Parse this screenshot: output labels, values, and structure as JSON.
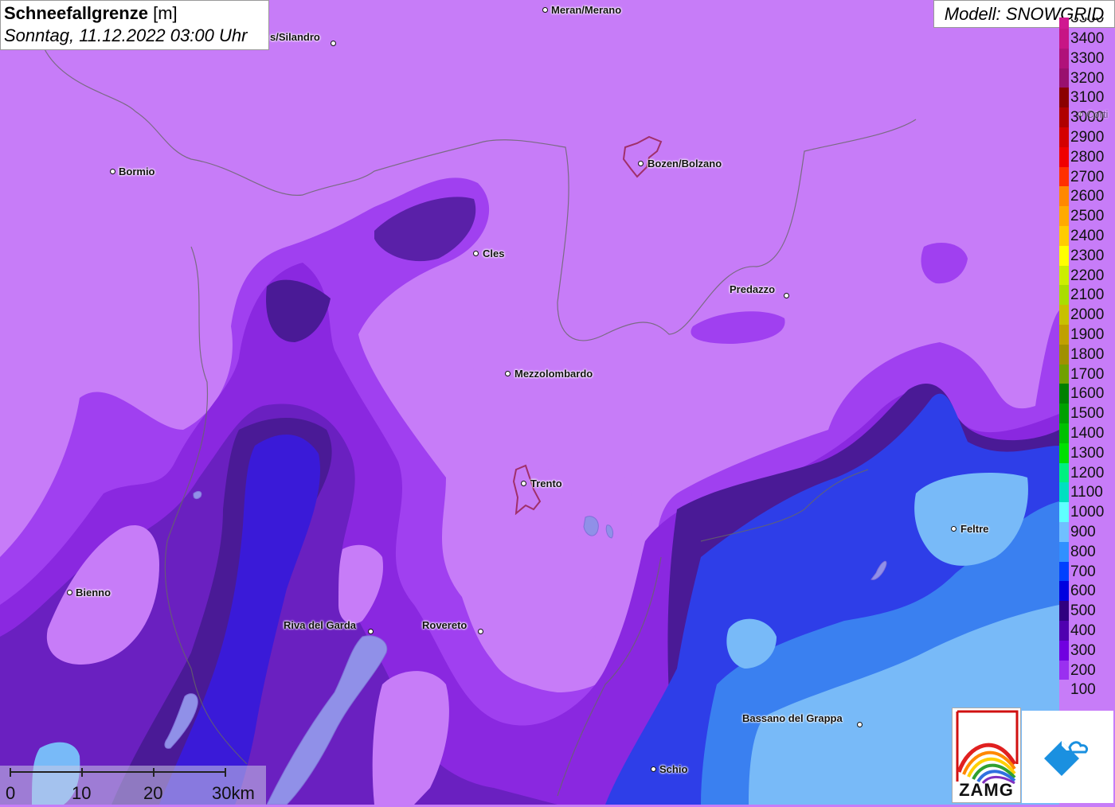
{
  "header": {
    "title_bold": "Schneefallgrenze",
    "title_unit": "[m]",
    "datetime": "Sonntag, 11.12.2022 03:00 Uhr"
  },
  "model": {
    "label": "Modell: SNOWGRID"
  },
  "legend": {
    "top_label_partial": "3500",
    "entries": [
      {
        "value": "3400",
        "color": "#c71585"
      },
      {
        "value": "3300",
        "color": "#b0127a"
      },
      {
        "value": "3200",
        "color": "#99106e"
      },
      {
        "value": "3100",
        "color": "#8b0000"
      },
      {
        "value": "3000",
        "color": "#b00000"
      },
      {
        "value": "2900",
        "color": "#d40000"
      },
      {
        "value": "2800",
        "color": "#f00000"
      },
      {
        "value": "2700",
        "color": "#ff3000"
      },
      {
        "value": "2600",
        "color": "#ff8800"
      },
      {
        "value": "2500",
        "color": "#ffaa00"
      },
      {
        "value": "2400",
        "color": "#ffcc00"
      },
      {
        "value": "2300",
        "color": "#ffff00"
      },
      {
        "value": "2200",
        "color": "#ccee00"
      },
      {
        "value": "2100",
        "color": "#aadd00"
      },
      {
        "value": "2000",
        "color": "#c8c000"
      },
      {
        "value": "1900",
        "color": "#c0a000"
      },
      {
        "value": "1800",
        "color": "#a09000"
      },
      {
        "value": "1700",
        "color": "#70a000"
      },
      {
        "value": "1600",
        "color": "#008000"
      },
      {
        "value": "1500",
        "color": "#00a000"
      },
      {
        "value": "1400",
        "color": "#00c000"
      },
      {
        "value": "1300",
        "color": "#00e000"
      },
      {
        "value": "1200",
        "color": "#00f080"
      },
      {
        "value": "1100",
        "color": "#00e0c0"
      },
      {
        "value": "1000",
        "color": "#60ffff"
      },
      {
        "value": "900",
        "color": "#70c0ff"
      },
      {
        "value": "800",
        "color": "#3090ff"
      },
      {
        "value": "700",
        "color": "#0040ff"
      },
      {
        "value": "600",
        "color": "#0000e0"
      },
      {
        "value": "500",
        "color": "#300080"
      },
      {
        "value": "400",
        "color": "#5000b0"
      },
      {
        "value": "300",
        "color": "#7000e0"
      },
      {
        "value": "200",
        "color": "#9a30f0"
      },
      {
        "value": "100",
        "color": "#c77cf8"
      }
    ]
  },
  "places": [
    {
      "name": "Meran/Merano"
    },
    {
      "name": "s/Silandro"
    },
    {
      "name": "Bormio"
    },
    {
      "name": "Bozen/Bolzano"
    },
    {
      "name": "Cles"
    },
    {
      "name": "Predazzo"
    },
    {
      "name": "Mezzolombardo"
    },
    {
      "name": "Trento"
    },
    {
      "name": "Feltre"
    },
    {
      "name": "Bienno"
    },
    {
      "name": "Riva del Garda"
    },
    {
      "name": "Rovereto"
    },
    {
      "name": "Bassano del Grappa"
    },
    {
      "name": "Schio"
    },
    {
      "name": "Corti"
    }
  ],
  "scalebar": {
    "labels": [
      "0",
      "10",
      "20",
      "30km"
    ]
  },
  "logos": {
    "zamg": "ZAMG"
  },
  "colors": {
    "band_100": "#c77cf8",
    "band_200": "#9a30f0",
    "band_300": "#7a20d8",
    "band_400": "#5a20a8",
    "band_500": "#3c1a80",
    "band_600": "#2a10c8",
    "band_700": "#2e3ee8",
    "band_800": "#3a80f0",
    "band_900": "#78baf8",
    "band_1000": "#8ad0fc"
  }
}
